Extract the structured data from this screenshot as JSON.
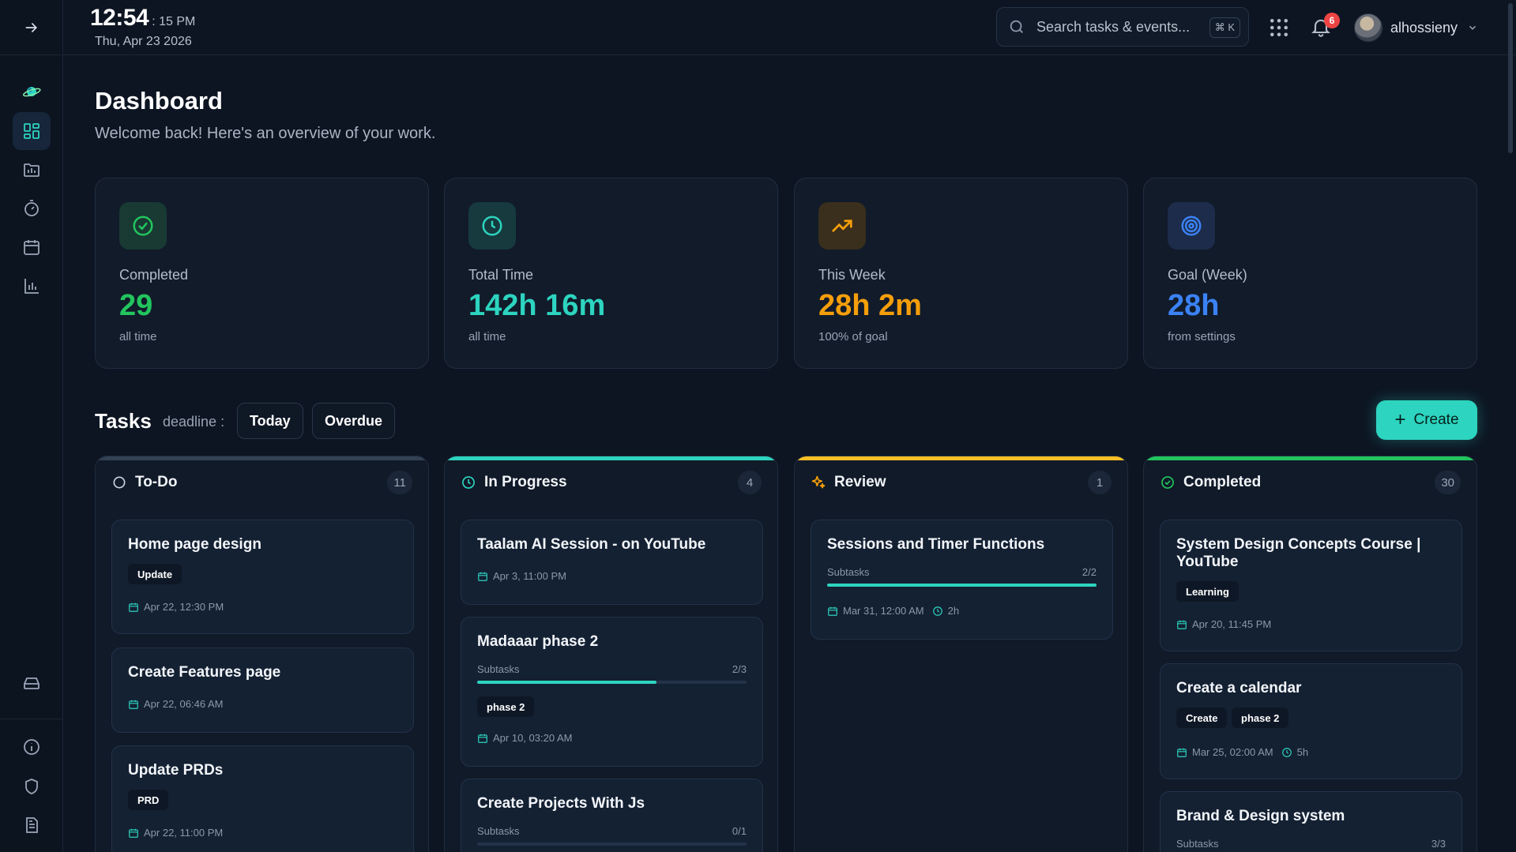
{
  "clock": {
    "time": "12:54",
    "period": ": 15 PM",
    "date": "Thu, Apr 23 2026"
  },
  "search": {
    "placeholder": "Search tasks & events...",
    "shortcut": "⌘ K"
  },
  "notifications": {
    "count": "6"
  },
  "user": {
    "name": "alhossieny"
  },
  "page": {
    "title": "Dashboard",
    "subtitle": "Welcome back! Here's an overview of your work."
  },
  "stats": [
    {
      "label": "Completed",
      "value": "29",
      "note": "all time",
      "color": "#22c55e"
    },
    {
      "label": "Total Time",
      "value": "142h 16m",
      "note": "all time",
      "color": "#2dd4bf"
    },
    {
      "label": "This Week",
      "value": "28h 2m",
      "note": "100% of goal",
      "color": "#f59e0b"
    },
    {
      "label": "Goal (Week)",
      "value": "28h",
      "note": "from settings",
      "color": "#3b82f6"
    }
  ],
  "tasks": {
    "title": "Tasks",
    "deadline_label": "deadline :",
    "filters": [
      "Today",
      "Overdue"
    ],
    "create_label": "Create"
  },
  "columns": [
    {
      "title": "To-Do",
      "count": "11",
      "accent": "#334155",
      "cards": [
        {
          "title": "Home page design",
          "tags": [
            "Update"
          ],
          "date": "Apr 22, 12:30 PM"
        },
        {
          "title": "Create Features page",
          "date": "Apr 22, 06:46 AM"
        },
        {
          "title": "Update PRDs",
          "tags": [
            "PRD"
          ],
          "date": "Apr 22, 11:00 PM"
        }
      ]
    },
    {
      "title": "In Progress",
      "count": "4",
      "accent": "#2dd4bf",
      "cards": [
        {
          "title": "Taalam AI Session - on YouTube",
          "date": "Apr 3, 11:00 PM"
        },
        {
          "title": "Madaaar phase 2",
          "subtasks_label": "Subtasks",
          "subtasks": "2/3",
          "progress": 0.667,
          "tags": [
            "phase 2"
          ],
          "date": "Apr 10, 03:20 AM"
        },
        {
          "title": "Create Projects With Js",
          "subtasks_label": "Subtasks",
          "subtasks": "0/1",
          "progress": 0
        }
      ]
    },
    {
      "title": "Review",
      "count": "1",
      "accent": "#fbbf24",
      "cards": [
        {
          "title": "Sessions and Timer Functions",
          "subtasks_label": "Subtasks",
          "subtasks": "2/2",
          "progress": 1,
          "date": "Mar 31, 12:00 AM",
          "duration": "2h"
        }
      ]
    },
    {
      "title": "Completed",
      "count": "30",
      "accent": "#22c55e",
      "cards": [
        {
          "title": "System Design Concepts Course | YouTube",
          "tags": [
            "Learning"
          ],
          "date": "Apr 20, 11:45 PM"
        },
        {
          "title": "Create a calendar",
          "tags": [
            "Create",
            "phase 2"
          ],
          "date": "Mar 25, 02:00 AM",
          "duration": "5h"
        },
        {
          "title": "Brand & Design system",
          "subtasks_label": "Subtasks",
          "subtasks": "3/3",
          "progress": 1
        }
      ]
    }
  ]
}
